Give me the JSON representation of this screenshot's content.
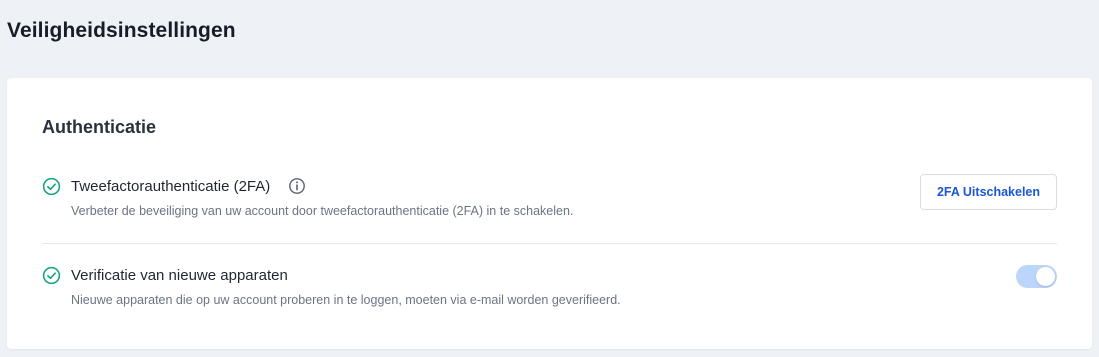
{
  "page": {
    "title": "Veiligheidsinstellingen"
  },
  "section": {
    "title": "Authenticatie"
  },
  "settings": [
    {
      "title": "Tweefactorauthenticatie (2FA)",
      "description": "Verbeter de beveiliging van uw account door tweefactorauthenticatie (2FA) in te schakelen.",
      "status_icon": "check-circle-icon",
      "info_icon": "info-circle-icon",
      "action_label": "2FA Uitschakelen"
    },
    {
      "title": "Verificatie van nieuwe apparaten",
      "description": "Nieuwe apparaten die op uw account proberen in te loggen, moeten via e-mail worden geverifieerd.",
      "status_icon": "check-circle-icon",
      "toggle_on": true
    }
  ],
  "colors": {
    "check": "#10a37f",
    "button_text": "#1a57d6",
    "toggle_track": "#bcd5fb"
  }
}
